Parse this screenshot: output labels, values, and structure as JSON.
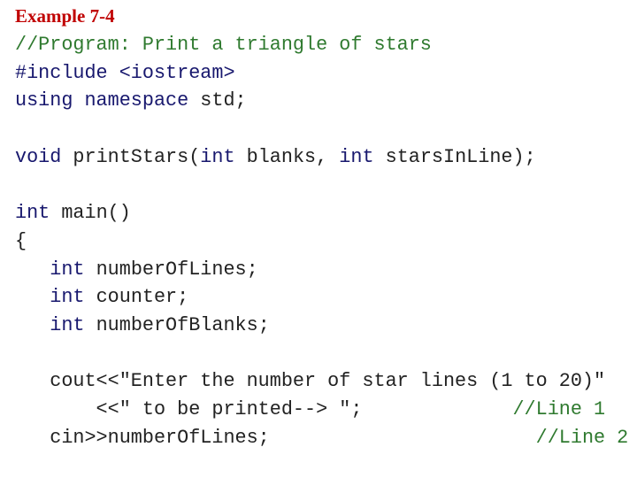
{
  "title": "Example 7-4",
  "code_lines": [
    [
      {
        "t": "c",
        "s": "//Program: Print a triangle of stars"
      }
    ],
    [
      {
        "t": "k",
        "s": "#include <iostream>"
      }
    ],
    [
      {
        "t": "k",
        "s": "using namespace "
      },
      {
        "t": "p",
        "s": "std;"
      }
    ],
    [
      {
        "t": "p",
        "s": ""
      }
    ],
    [
      {
        "t": "k",
        "s": "void "
      },
      {
        "t": "p",
        "s": "printStars("
      },
      {
        "t": "k",
        "s": "int "
      },
      {
        "t": "p",
        "s": "blanks, "
      },
      {
        "t": "k",
        "s": "int "
      },
      {
        "t": "p",
        "s": "starsInLine);"
      }
    ],
    [
      {
        "t": "p",
        "s": ""
      }
    ],
    [
      {
        "t": "k",
        "s": "int "
      },
      {
        "t": "p",
        "s": "main()"
      }
    ],
    [
      {
        "t": "p",
        "s": "{"
      }
    ],
    [
      {
        "t": "p",
        "s": "   "
      },
      {
        "t": "k",
        "s": "int "
      },
      {
        "t": "p",
        "s": "numberOfLines;"
      }
    ],
    [
      {
        "t": "p",
        "s": "   "
      },
      {
        "t": "k",
        "s": "int "
      },
      {
        "t": "p",
        "s": "counter;"
      }
    ],
    [
      {
        "t": "p",
        "s": "   "
      },
      {
        "t": "k",
        "s": "int "
      },
      {
        "t": "p",
        "s": "numberOfBlanks;"
      }
    ],
    [
      {
        "t": "p",
        "s": ""
      }
    ],
    [
      {
        "t": "p",
        "s": "   cout<<\"Enter the number of star lines (1 to 20)\""
      }
    ],
    [
      {
        "t": "p",
        "s": "       <<\" to be printed--> \";             "
      },
      {
        "t": "c",
        "s": "//Line 1"
      }
    ],
    [
      {
        "t": "p",
        "s": "   cin>>numberOfLines;                       "
      },
      {
        "t": "c",
        "s": "//Line 2"
      }
    ]
  ]
}
